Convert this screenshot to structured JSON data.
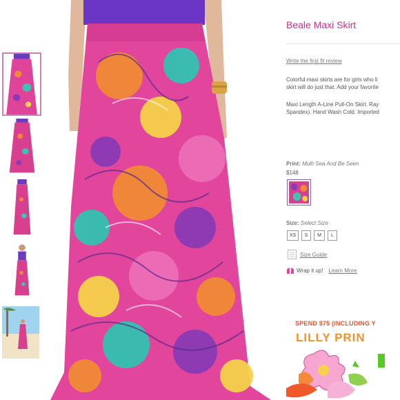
{
  "product": {
    "title": "Beale Maxi Skirt",
    "review_link": "Write the first fit review",
    "description_lines": [
      "Colorful maxi skirts are for girls who li",
      "skirt will do just that. Add your favorite",
      "Maxi Length A-Line Pull-On Skirt. Ray",
      "Spandex). Hand Wash Cold. Imported"
    ],
    "print_label": "Print:",
    "print_value": "Multi Sea And Be Seen",
    "price": "$148",
    "size_label": "Size:",
    "size_value": "Select Size",
    "sizes": [
      "XS",
      "S",
      "M",
      "L"
    ],
    "size_guide": "Size Guide",
    "wrap_label": "Wrap it up!",
    "learn_more": "Learn More"
  },
  "promo": {
    "line1": "SPEND $75 (INCLUDING Y",
    "line2": "LILLY PRIN"
  },
  "colors": {
    "brand_pink": "#c2338a",
    "promo_orange": "#e8552b",
    "promo_gold": "#f2922c",
    "promo_green": "#5ac82a",
    "thumb_border": "#d27fb5"
  }
}
